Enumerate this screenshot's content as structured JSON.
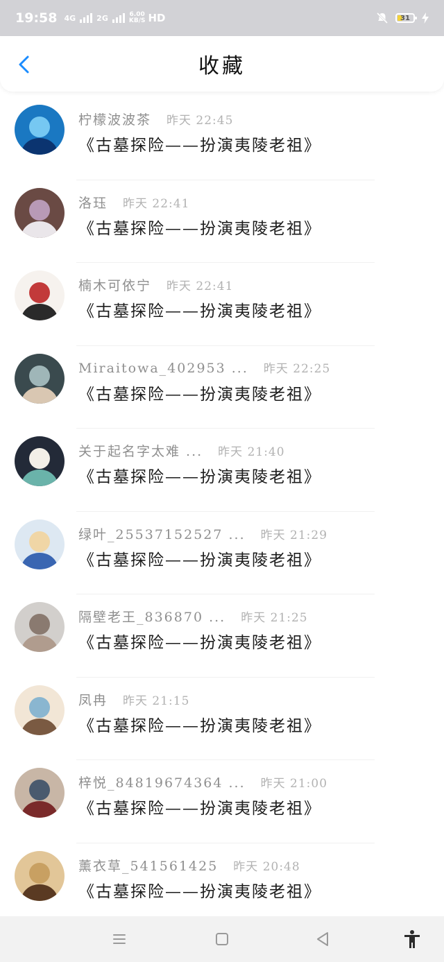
{
  "status_bar": {
    "time": "19:58",
    "network_1": "4G",
    "network_2": "2G",
    "speed_value": "6.00",
    "speed_unit": "KB/S",
    "hd": "HD",
    "battery": "31"
  },
  "header": {
    "title": "收藏"
  },
  "items": [
    {
      "name": "柠檬波波茶",
      "time": "昨天 22:45",
      "text": "《古墓探险——扮演夷陵老祖》",
      "avatar_colors": [
        "#1a78c2",
        "#0b3470",
        "#76c8f2"
      ]
    },
    {
      "name": "洛珏",
      "time": "昨天 22:41",
      "text": "《古墓探险——扮演夷陵老祖》",
      "avatar_colors": [
        "#6a4a44",
        "#eae6ea",
        "#b89ab6"
      ]
    },
    {
      "name": "楠木可依宁",
      "time": "昨天 22:41",
      "text": "《古墓探险——扮演夷陵老祖》",
      "avatar_colors": [
        "#f6f2ee",
        "#2a2a2a",
        "#c23a3a"
      ]
    },
    {
      "name": "Miraitowa_402953 ...",
      "time": "昨天 22:25",
      "text": "《古墓探险——扮演夷陵老祖》",
      "avatar_colors": [
        "#3a4a4e",
        "#d9c7b2",
        "#9fb6b8"
      ]
    },
    {
      "name": "关于起名字太难 ...",
      "time": "昨天 21:40",
      "text": "《古墓探险——扮演夷陵老祖》",
      "avatar_colors": [
        "#232a38",
        "#6ab3aa",
        "#f3efe8"
      ]
    },
    {
      "name": "绿叶_25537152527 ...",
      "time": "昨天 21:29",
      "text": "《古墓探险——扮演夷陵老祖》",
      "avatar_colors": [
        "#dde8f2",
        "#3a66b2",
        "#f0d6a6"
      ]
    },
    {
      "name": "隔壁老王_836870 ...",
      "time": "昨天 21:25",
      "text": "《古墓探险——扮演夷陵老祖》",
      "avatar_colors": [
        "#d2cfcc",
        "#b09c8e",
        "#8a7a70"
      ]
    },
    {
      "name": "凤冉",
      "time": "昨天 21:15",
      "text": "《古墓探险——扮演夷陵老祖》",
      "avatar_colors": [
        "#f2e6d6",
        "#7a5a42",
        "#8ab6d0"
      ]
    },
    {
      "name": "梓悦_84819674364 ...",
      "time": "昨天 21:00",
      "text": "《古墓探险——扮演夷陵老祖》",
      "avatar_colors": [
        "#c8b6a6",
        "#7a2a2a",
        "#4a5a6e"
      ]
    },
    {
      "name": "薰衣草_541561425",
      "time": "昨天 20:48",
      "text": "《古墓探险——扮演夷陵老祖》",
      "avatar_colors": [
        "#e2c698",
        "#5a3a22",
        "#c8a062"
      ]
    }
  ],
  "colors": {
    "accent": "#1a8cff",
    "status_bar_bg": "#d2d2d6",
    "nav_bar_bg": "#f2f2f2"
  },
  "icons": {
    "back": "chevron-left-icon",
    "menu": "menu-icon",
    "home": "home-square-icon",
    "back_triangle": "back-triangle-icon",
    "accessibility": "accessibility-icon"
  }
}
